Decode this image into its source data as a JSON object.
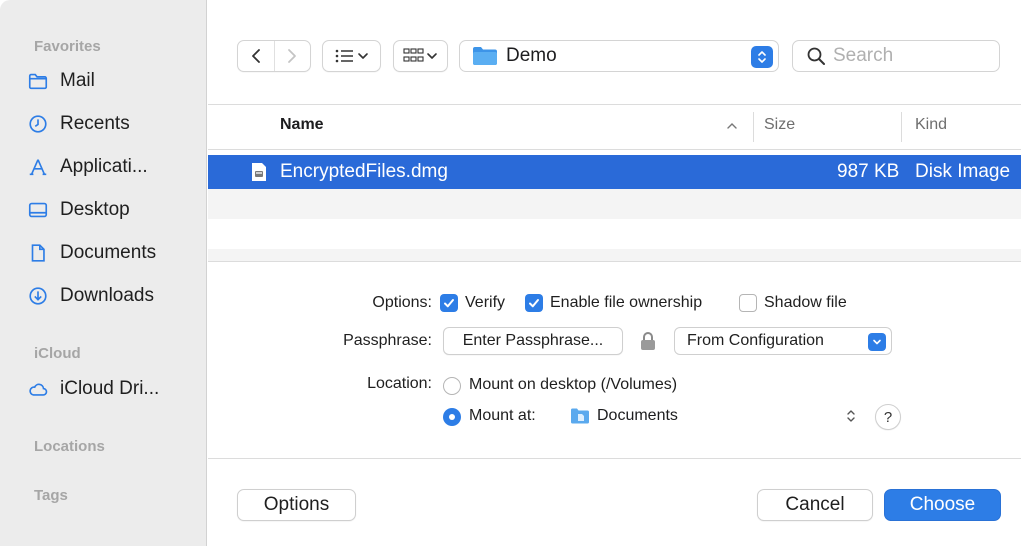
{
  "sidebar": {
    "sections": {
      "favorites": "Favorites",
      "icloud": "iCloud",
      "locations": "Locations",
      "tags": "Tags"
    },
    "favorites": [
      {
        "label": "Mail",
        "icon": "folder-icon"
      },
      {
        "label": "Recents",
        "icon": "clock-icon"
      },
      {
        "label": "Applicati...",
        "icon": "applications-icon"
      },
      {
        "label": "Desktop",
        "icon": "desktop-icon"
      },
      {
        "label": "Documents",
        "icon": "document-icon"
      },
      {
        "label": "Downloads",
        "icon": "download-icon"
      }
    ],
    "icloud": [
      {
        "label": "iCloud Dri...",
        "icon": "cloud-icon"
      }
    ]
  },
  "toolbar": {
    "location": "Demo",
    "search_placeholder": "Search"
  },
  "file_list": {
    "columns": {
      "name": "Name",
      "size": "Size",
      "kind": "Kind"
    },
    "rows": [
      {
        "name": "EncryptedFiles.dmg",
        "size": "987 KB",
        "kind": "Disk Image"
      }
    ]
  },
  "options": {
    "options_label": "Options:",
    "verify": {
      "label": "Verify",
      "checked": true
    },
    "ownership": {
      "label": "Enable file ownership",
      "checked": true
    },
    "shadow": {
      "label": "Shadow file",
      "checked": false
    },
    "passphrase_label": "Passphrase:",
    "passphrase_button": "Enter Passphrase...",
    "passphrase_source": "From Configuration",
    "location_label": "Location:",
    "mount_desktop": "Mount on desktop (/Volumes)",
    "mount_at": "Mount at:",
    "mount_folder": "Documents",
    "help": "?"
  },
  "buttons": {
    "options": "Options",
    "cancel": "Cancel",
    "choose": "Choose"
  },
  "colors": {
    "accent": "#2d7de6",
    "selection": "#2a6ad8",
    "sidebar_bg": "#ececec"
  }
}
